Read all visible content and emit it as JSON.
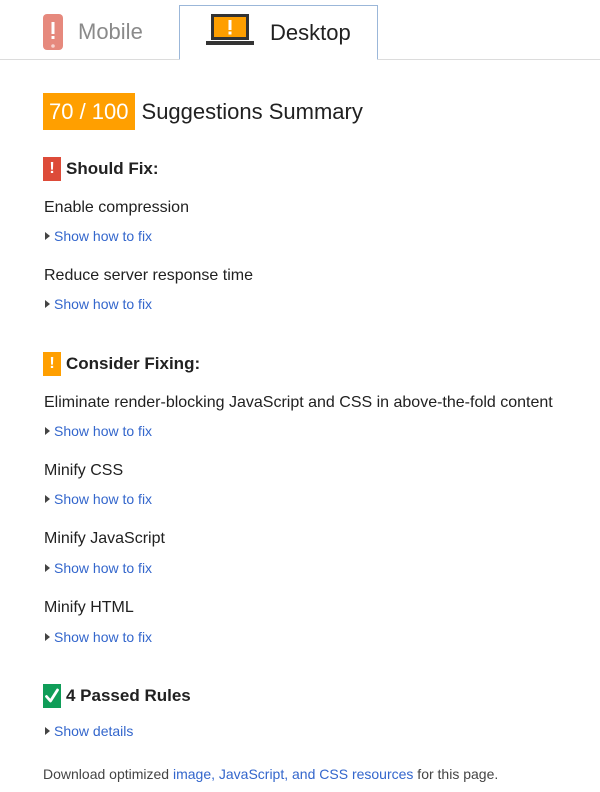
{
  "tabs": {
    "mobile_label": "Mobile",
    "desktop_label": "Desktop",
    "active": "Desktop"
  },
  "summary": {
    "score": "70 / 100",
    "title": "Suggestions Summary",
    "score_color": "#ff9f00"
  },
  "should_fix": {
    "title": "Should Fix:",
    "flag_color": "#dd4b39",
    "rules": [
      {
        "name": "Enable compression",
        "link": "Show how to fix"
      },
      {
        "name": "Reduce server response time",
        "link": "Show how to fix"
      }
    ]
  },
  "consider_fixing": {
    "title": "Consider Fixing:",
    "flag_color": "#ff9f00",
    "rules": [
      {
        "name": "Eliminate render-blocking JavaScript and CSS in above-the-fold content",
        "link": "Show how to fix"
      },
      {
        "name": "Minify CSS",
        "link": "Show how to fix"
      },
      {
        "name": "Minify JavaScript",
        "link": "Show how to fix"
      },
      {
        "name": "Minify HTML",
        "link": "Show how to fix"
      }
    ]
  },
  "passed": {
    "title": "4 Passed Rules",
    "flag_color": "#0f9d58",
    "link": "Show details"
  },
  "footer": {
    "prefix": "Download optimized ",
    "link": "image, JavaScript, and CSS resources",
    "suffix": " for this page."
  },
  "icons": {
    "mobile_tab": "mobile-warning-icon",
    "desktop_tab": "desktop-warning-icon",
    "should_fix": "exclamation-icon",
    "consider_fixing": "exclamation-icon",
    "passed": "checkmark-icon",
    "expander": "triangle-right-icon"
  }
}
